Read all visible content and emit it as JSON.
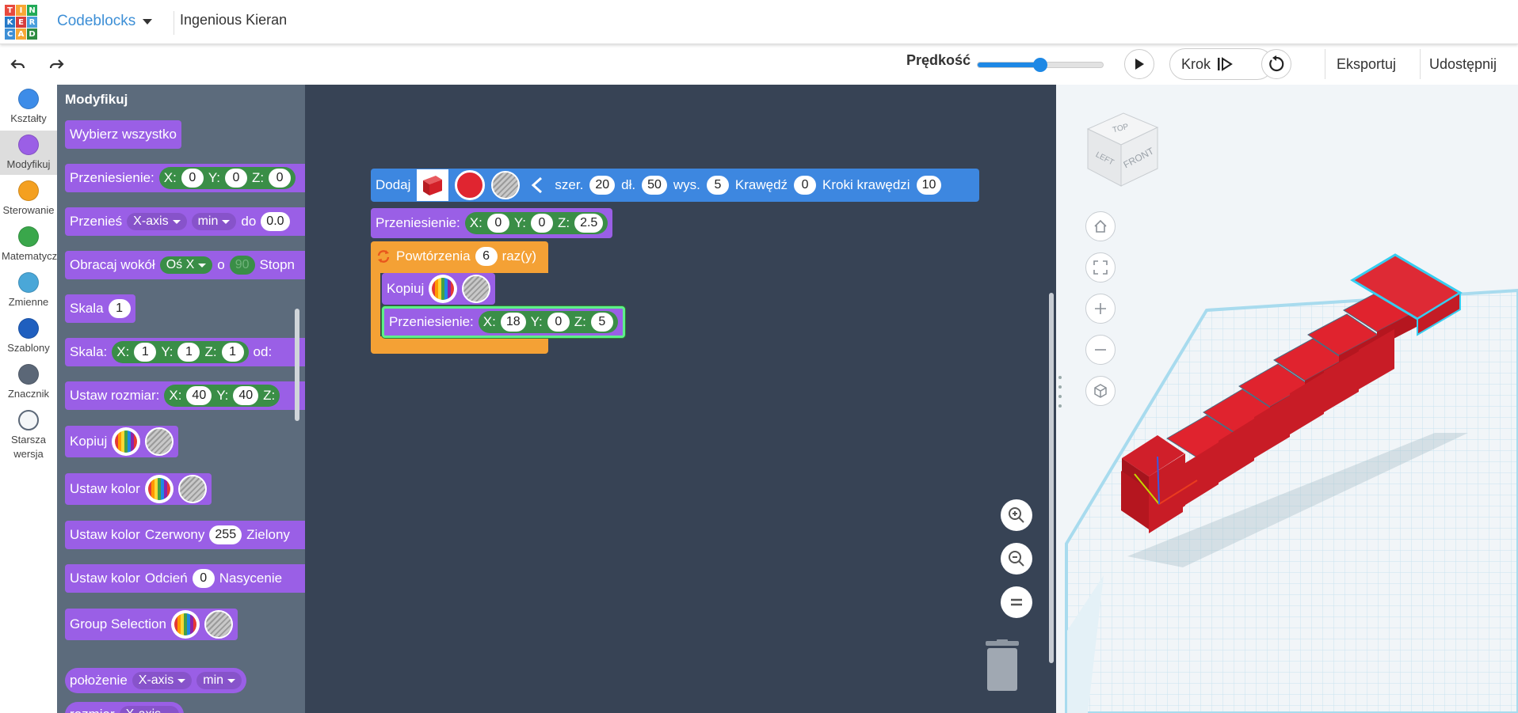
{
  "header": {
    "logo_letters": [
      "T",
      "I",
      "N",
      "K",
      "E",
      "R",
      "C",
      "A",
      "D"
    ],
    "logo_colors": [
      "#e84a3e",
      "#f7a734",
      "#22aa58",
      "#2579c8",
      "#d63d3d",
      "#4a9fdc",
      "#3d8fd6",
      "#f7a734",
      "#2e8c40"
    ],
    "app_name": "Codeblocks",
    "project_name": "Ingenious Kieran"
  },
  "toolbar": {
    "speed_label": "Prędkość",
    "speed_fraction": 0.5,
    "step_label": "Krok",
    "export_label": "Eksportuj",
    "share_label": "Udostępnij"
  },
  "categories": [
    {
      "label": "Kształty",
      "color": "#3d8ce8"
    },
    {
      "label": "Modyfikuj",
      "color": "#9b5fe6",
      "active": true
    },
    {
      "label": "Sterowanie",
      "color": "#f4a020"
    },
    {
      "label": "Matematycz",
      "color": "#3aa74b"
    },
    {
      "label": "Zmienne",
      "color": "#4aa7d8"
    },
    {
      "label": "Szablony",
      "color": "#1f5fbf"
    },
    {
      "label": "Znacznik",
      "color": "#5b6777"
    },
    {
      "label": "Starsza wersja",
      "color": "#f4f6f8"
    }
  ],
  "palette": {
    "title": "Modyfikuj",
    "select_all": "Wybierz wszystko",
    "move": {
      "label": "Przeniesienie:",
      "x_lbl": "X:",
      "x": "0",
      "y_lbl": "Y:",
      "y": "0",
      "z_lbl": "Z:",
      "z": "0"
    },
    "move_to": {
      "label": "Przenieś",
      "axis": "X-axis",
      "mode": "min",
      "to_lbl": "do",
      "to": "0.0"
    },
    "rotate": {
      "label": "Obracaj wokół",
      "axis": "Oś X",
      "o_lbl": "o",
      "deg": "90",
      "deg_lbl": "Stopn"
    },
    "scale": {
      "label": "Skala",
      "val": "1"
    },
    "scale_xyz": {
      "label": "Skala:",
      "x_lbl": "X:",
      "x": "1",
      "y_lbl": "Y:",
      "y": "1",
      "z_lbl": "Z:",
      "z": "1",
      "from_lbl": "od:"
    },
    "set_size": {
      "label": "Ustaw rozmiar:",
      "x_lbl": "X:",
      "x": "40",
      "y_lbl": "Y:",
      "y": "40",
      "z_lbl": "Z:"
    },
    "copy": "Kopiuj",
    "set_color": "Ustaw kolor",
    "set_color_rgb": {
      "label": "Ustaw kolor",
      "red_lbl": "Czerwony",
      "red": "255",
      "green_lbl": "Zielony"
    },
    "set_color_hsv": {
      "label": "Ustaw kolor",
      "hue_lbl": "Odcień",
      "hue": "0",
      "sat_lbl": "Nasycenie"
    },
    "group": "Group Selection",
    "position": {
      "label": "położenie",
      "axis": "X-axis",
      "mode": "min"
    },
    "size_partial": {
      "label": "rozmiar",
      "axis": "X-axis"
    }
  },
  "script": {
    "add": {
      "label": "Dodaj",
      "w_lbl": "szer.",
      "w": "20",
      "l_lbl": "dł.",
      "l": "50",
      "h_lbl": "wys.",
      "h": "5",
      "edge_lbl": "Krawędź",
      "edge": "0",
      "steps_lbl": "Kroki krawędzi",
      "steps": "10",
      "shape_color": "#d9252e"
    },
    "move1": {
      "label": "Przeniesienie:",
      "x_lbl": "X:",
      "x": "0",
      "y_lbl": "Y:",
      "y": "0",
      "z_lbl": "Z:",
      "z": "2.5"
    },
    "repeat": {
      "label": "Powtórzenia",
      "count": "6",
      "suffix": "raz(y)"
    },
    "copy": {
      "label": "Kopiuj"
    },
    "move2": {
      "label": "Przeniesienie:",
      "x_lbl": "X:",
      "x": "18",
      "y_lbl": "Y:",
      "y": "0",
      "z_lbl": "Z:",
      "z": "5"
    }
  },
  "viewcube": {
    "top": "TOP",
    "left": "LEFT",
    "front": "FRONT"
  },
  "colors": {
    "accent": "#1e88e5",
    "stairs": "#d9252e"
  }
}
